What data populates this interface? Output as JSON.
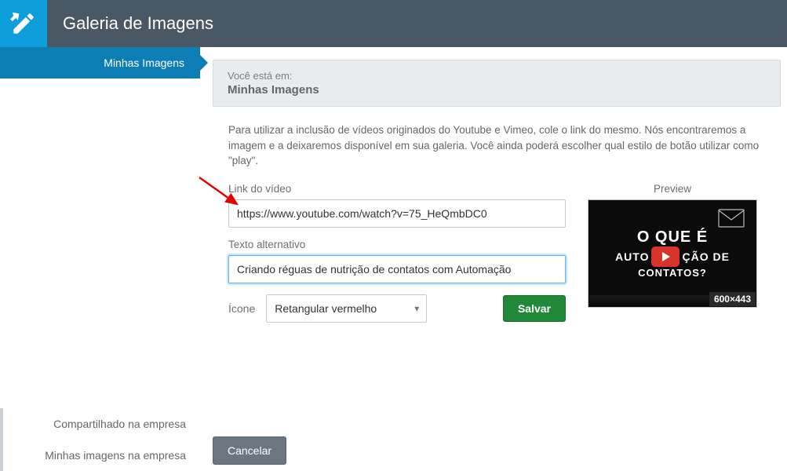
{
  "header": {
    "title": "Galeria de Imagens"
  },
  "sidebar": {
    "active": {
      "label": "Minhas Imagens"
    },
    "bottom": [
      {
        "label": "Compartilhado na empresa"
      },
      {
        "label": "Minhas imagens na empresa"
      }
    ]
  },
  "breadcrumb": {
    "prefix": "Você está em:",
    "title": "Minhas Imagens"
  },
  "form": {
    "helpText": "Para utilizar a inclusão de vídeos originados do Youtube e Vimeo, cole o link do mesmo. Nós encontraremos a imagem e a deixaremos disponível em sua galeria. Você ainda poderá escolher qual estilo de botão utilizar como \"play\".",
    "linkLabel": "Link do vídeo",
    "linkValue": "https://www.youtube.com/watch?v=75_HeQmbDC0",
    "altLabel": "Texto alternativo",
    "altValue": "Criando réguas de nutrição de contatos com Automação",
    "iconLabel": "Ícone",
    "iconSelected": "Retangular vermelho",
    "saveLabel": "Salvar",
    "cancelLabel": "Cancelar"
  },
  "preview": {
    "label": "Preview",
    "line1": "O QUE É",
    "line2a": "AUTO",
    "line2b": "ÇÃO DE",
    "line3": "CONTATOS?",
    "dimensions": "600×443"
  }
}
